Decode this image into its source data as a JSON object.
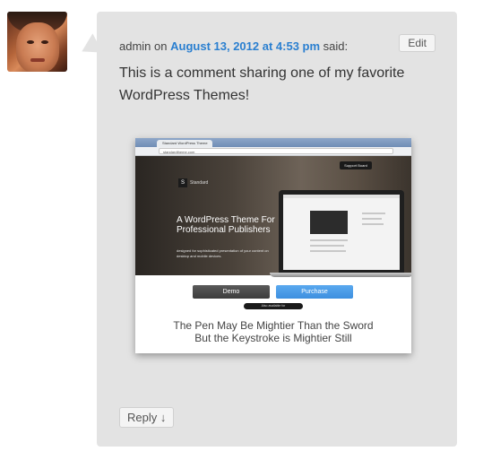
{
  "avatar": {
    "alt": "commenter avatar"
  },
  "comment": {
    "author": "admin",
    "on_word": "on",
    "date": "August 13, 2012 at 4:53 pm",
    "said": "said:",
    "edit_label": "Edit",
    "body": "This is a comment sharing one of my favorite WordPress Themes!",
    "reply_label": "Reply ↓"
  },
  "embedded_screenshot": {
    "tab_title": "Standard WordPress Theme",
    "address": "standardtheme.com",
    "support_label": "Support Board",
    "logo_letter": "S",
    "logo_text": "Standard",
    "hero_title": "A WordPress Theme For Professional Publishers",
    "hero_sub": "designed for sophisticated presentation of your content on desktop and mobile devices.",
    "demo_label": "Demo",
    "purchase_label": "Purchase",
    "also_available": "Also available for",
    "tagline_line1": "The Pen May Be Mightier Than the Sword",
    "tagline_line2": "But the Keystroke is Mightier Still"
  },
  "colors": {
    "bubble_bg": "#e3e3e3",
    "date_link": "#2a7fd0",
    "purchase_blue": "#3d8fdf"
  }
}
